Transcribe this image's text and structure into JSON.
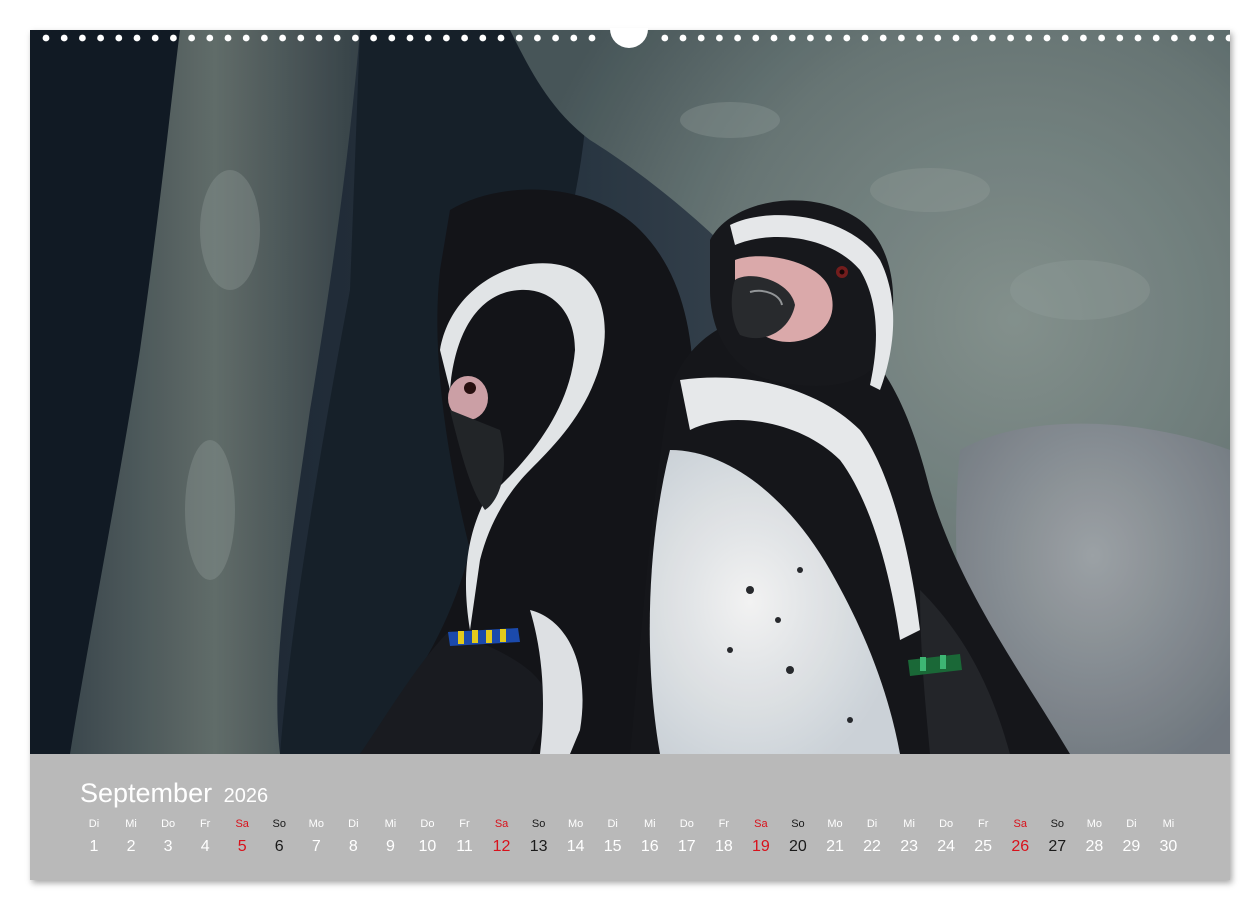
{
  "calendar": {
    "month": "September",
    "year": "2026",
    "days": [
      {
        "wd": "Di",
        "d": "1",
        "t": "w"
      },
      {
        "wd": "Mi",
        "d": "2",
        "t": "w"
      },
      {
        "wd": "Do",
        "d": "3",
        "t": "w"
      },
      {
        "wd": "Fr",
        "d": "4",
        "t": "w"
      },
      {
        "wd": "Sa",
        "d": "5",
        "t": "sat"
      },
      {
        "wd": "So",
        "d": "6",
        "t": "sun"
      },
      {
        "wd": "Mo",
        "d": "7",
        "t": "w"
      },
      {
        "wd": "Di",
        "d": "8",
        "t": "w"
      },
      {
        "wd": "Mi",
        "d": "9",
        "t": "w"
      },
      {
        "wd": "Do",
        "d": "10",
        "t": "w"
      },
      {
        "wd": "Fr",
        "d": "11",
        "t": "w"
      },
      {
        "wd": "Sa",
        "d": "12",
        "t": "sat"
      },
      {
        "wd": "So",
        "d": "13",
        "t": "sun"
      },
      {
        "wd": "Mo",
        "d": "14",
        "t": "w"
      },
      {
        "wd": "Di",
        "d": "15",
        "t": "w"
      },
      {
        "wd": "Mi",
        "d": "16",
        "t": "w"
      },
      {
        "wd": "Do",
        "d": "17",
        "t": "w"
      },
      {
        "wd": "Fr",
        "d": "18",
        "t": "w"
      },
      {
        "wd": "Sa",
        "d": "19",
        "t": "sat"
      },
      {
        "wd": "So",
        "d": "20",
        "t": "sun"
      },
      {
        "wd": "Mo",
        "d": "21",
        "t": "w"
      },
      {
        "wd": "Di",
        "d": "22",
        "t": "w"
      },
      {
        "wd": "Mi",
        "d": "23",
        "t": "w"
      },
      {
        "wd": "Do",
        "d": "24",
        "t": "w"
      },
      {
        "wd": "Fr",
        "d": "25",
        "t": "w"
      },
      {
        "wd": "Sa",
        "d": "26",
        "t": "sat"
      },
      {
        "wd": "So",
        "d": "27",
        "t": "sun"
      },
      {
        "wd": "Mo",
        "d": "28",
        "t": "w"
      },
      {
        "wd": "Di",
        "d": "29",
        "t": "w"
      },
      {
        "wd": "Mi",
        "d": "30",
        "t": "w"
      }
    ]
  },
  "colors": {
    "calendar_background": "#b9b9b9",
    "weekday_text": "#ffffff",
    "saturday": "#d9111b",
    "sunday": "#1a1a1a"
  },
  "photo": {
    "subject_icon": "penguins-photo"
  }
}
